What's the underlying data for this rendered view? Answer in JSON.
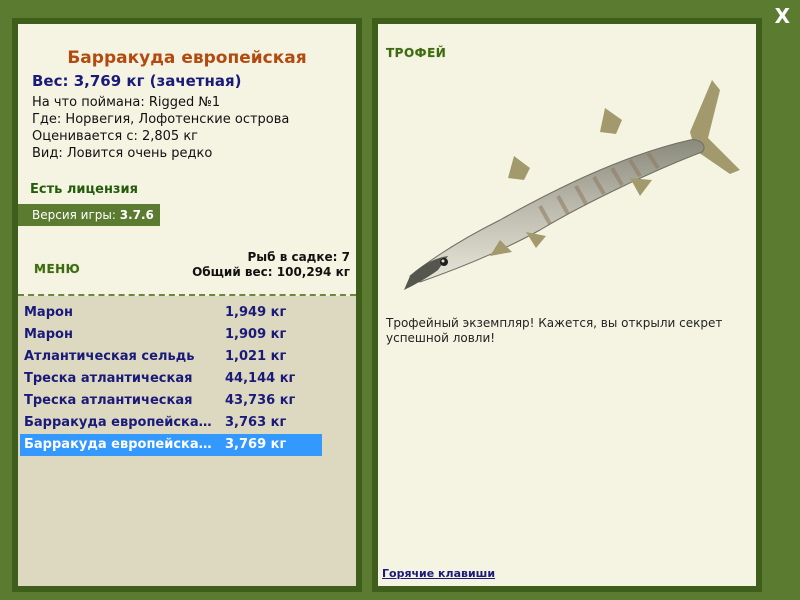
{
  "window": {
    "close_label": "X"
  },
  "fish": {
    "name": "Барракуда европейская",
    "weight_line": "Вес: 3,769 кг (зачетная)",
    "details": [
      "На что поймана: Rigged №1",
      "Где: Норвегия, Лофотенские острова",
      "Оценивается с: 2,805 кг",
      "Вид: Ловится очень редко"
    ]
  },
  "license": "Есть лицензия",
  "version": {
    "prefix": "Версия игры: ",
    "number": "3.7.6"
  },
  "menu_label": "МЕНЮ",
  "stats": {
    "fish_in_keepnet": "Рыб в садке: 7",
    "total_weight": "Общий вес: 100,294 кг"
  },
  "catch_list": [
    {
      "name": "Марон",
      "weight": "1,949 кг"
    },
    {
      "name": "Марон",
      "weight": "1,909 кг"
    },
    {
      "name": "Атлантическая сельдь",
      "weight": "1,021 кг"
    },
    {
      "name": "Треска атлантическая",
      "weight": "44,144 кг"
    },
    {
      "name": "Треска атлантическая",
      "weight": "43,736 кг"
    },
    {
      "name": "Барракуда европейска…",
      "weight": "3,763 кг"
    },
    {
      "name": "Барракуда европейска…",
      "weight": "3,769 кг"
    }
  ],
  "selected_index": 6,
  "trophy": {
    "label": "ТРОФЕЙ",
    "text": "Трофейный экземпляр! Кажется, вы открыли секрет успешной ловли!"
  },
  "hotkeys_label": "Горячие клавиши",
  "colors": {
    "frame": "#5b7b30",
    "panel_bg": "#f5f4e2",
    "list_bg": "#dcd9c0",
    "selection": "#3399ff",
    "fish_name": "#b34a10",
    "text_blue": "#1a1a7a"
  }
}
